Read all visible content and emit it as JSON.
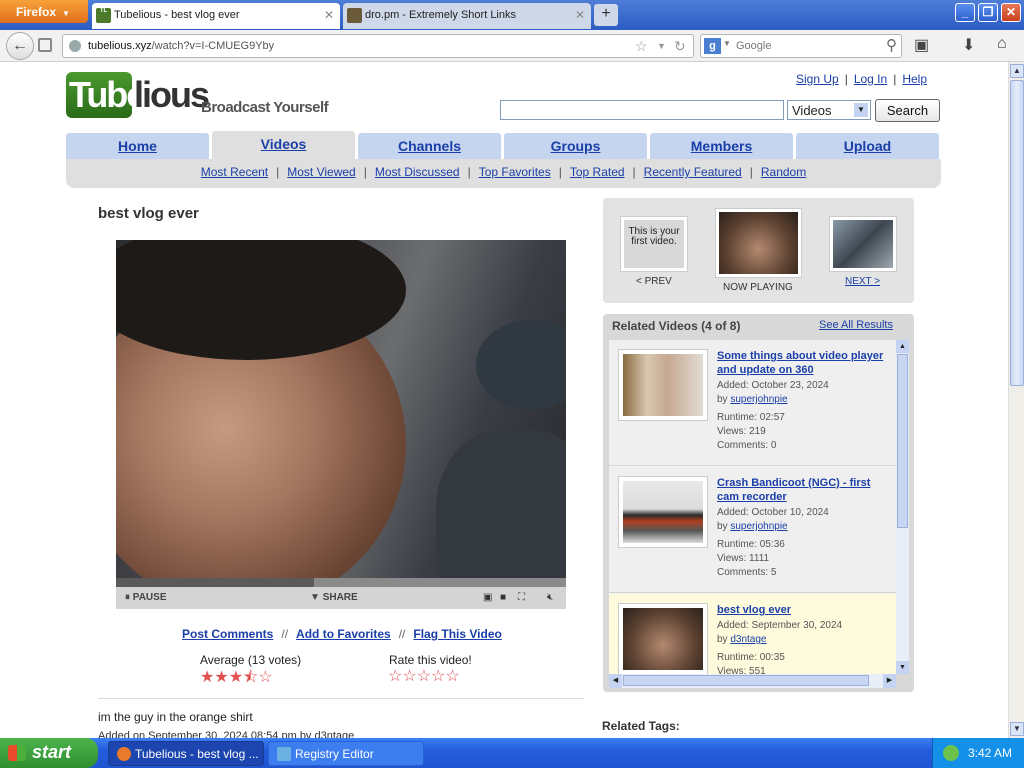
{
  "browser": {
    "menu_button": "Firefox",
    "tabs": [
      {
        "title": "Tubelious - best vlog ever",
        "favicon": "TL"
      },
      {
        "title": "dro.pm - Extremely Short Links",
        "favicon": ""
      }
    ],
    "new_tab": "+",
    "url_domain": "tubelious.xyz",
    "url_path": "/watch?v=I-CMUEG9Yby",
    "search_placeholder": "Google",
    "window_buttons": {
      "minimize": "_",
      "maximize": "❐",
      "close": "✕"
    }
  },
  "site": {
    "logo_part1": "Tube",
    "logo_part2": "lious",
    "tagline": "Broadcast Yourself",
    "top_links": [
      "Sign Up",
      "Log In",
      "Help"
    ],
    "search_category": "Videos",
    "search_button": "Search",
    "nav_tabs": [
      "Home",
      "Videos",
      "Channels",
      "Groups",
      "Members",
      "Upload"
    ],
    "nav_selected": "Videos",
    "sub_nav": [
      "Most Recent",
      "Most Viewed",
      "Most Discussed",
      "Top Favorites",
      "Top Rated",
      "Recently Featured",
      "Random"
    ]
  },
  "video": {
    "title": "best vlog ever",
    "progress": 0.44,
    "pause_label": "PAUSE",
    "share_label": "SHARE",
    "actions": [
      "Post Comments",
      "Add to Favorites",
      "Flag This Video"
    ],
    "average_label": "Average (13 votes)",
    "rating": 3.5,
    "rate_label": "Rate this video!",
    "description": "im the guy in the orange shirt",
    "added_line": "Added on September 30, 2024 08:54 pm by d3ntage"
  },
  "prev_next": {
    "prev_thumb_text": "This is your first video.",
    "prev_label": "< PREV",
    "now_label": "NOW PLAYING",
    "next_label": "NEXT >"
  },
  "related": {
    "header": "Related Videos (4 of 8)",
    "see_all": "See All Results",
    "items": [
      {
        "title": "Some things about video player and update on 360",
        "added": "Added: October 23, 2024",
        "by_label": "by",
        "user": "superjohnpie",
        "runtime": "Runtime: 02:57",
        "views": "Views: 219",
        "comments": "Comments: 0"
      },
      {
        "title": "Crash Bandicoot (NGC) - first cam recorder",
        "added": "Added: October 10, 2024",
        "by_label": "by",
        "user": "superjohnpie",
        "runtime": "Runtime: 05:36",
        "views": "Views: 1111",
        "comments": "Comments: 5"
      },
      {
        "title": "best vlog ever",
        "added": "Added: September 30, 2024",
        "by_label": "by",
        "user": "d3ntage",
        "runtime": "Runtime: 00:35",
        "views": "Views: 551",
        "comments": ""
      }
    ],
    "tags_label": "Related Tags:"
  },
  "taskbar": {
    "start": "start",
    "tasks": [
      "Tubelious - best vlog ...",
      "Registry Editor"
    ],
    "clock": "3:42 AM"
  }
}
